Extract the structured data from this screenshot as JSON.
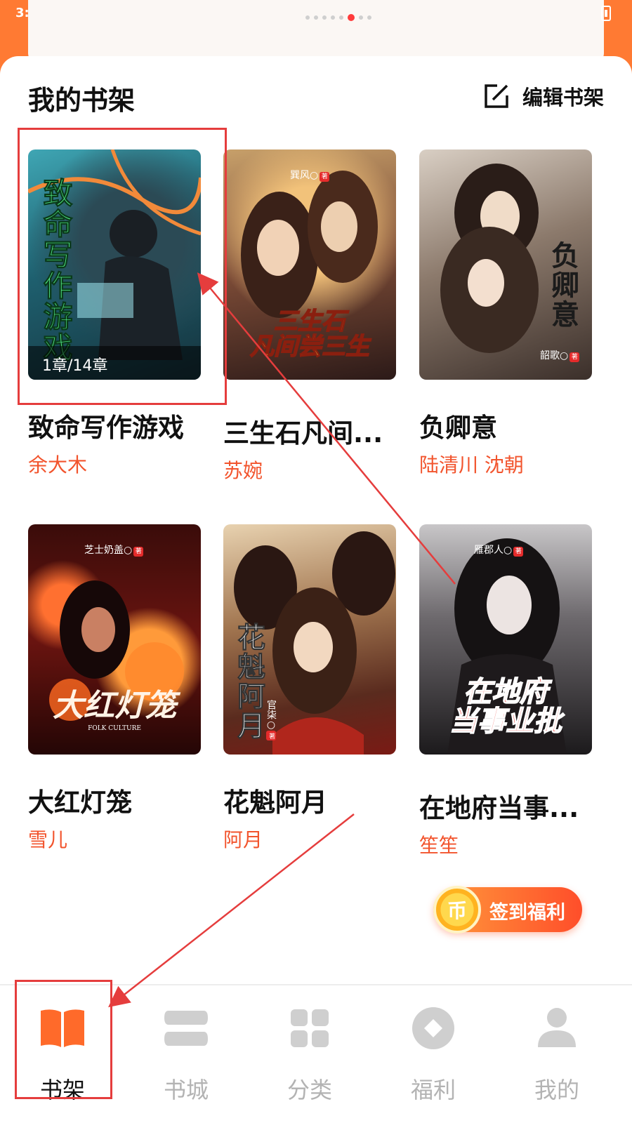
{
  "status": {
    "time": "3:"
  },
  "shelf": {
    "title": "我的书架",
    "edit_label": "编辑书架"
  },
  "books": [
    {
      "name": "致命写作游戏",
      "author": "余大木",
      "cover_title": "致命写作游戏",
      "progress": "1章/14章",
      "cover_author": ""
    },
    {
      "name": "三生石凡间...",
      "author": "苏婉",
      "cover_title": "三生石\n凡间尝三生",
      "cover_author": "巽风"
    },
    {
      "name": "负卿意",
      "author": "陆清川 沈朝",
      "cover_title": "负卿意",
      "cover_author": "韶歌"
    },
    {
      "name": "大红灯笼",
      "author": "雪儿",
      "cover_title": "大红灯笼",
      "cover_subtitle": "FOLK CULTURE",
      "cover_author": "芝士奶盖"
    },
    {
      "name": "花魁阿月",
      "author": "阿月",
      "cover_title": "花魁阿月",
      "cover_author": "官柒"
    },
    {
      "name": "在地府当事...",
      "author": "笙笙",
      "cover_title": "在地府\n当事业批",
      "cover_author": "雁郡人"
    }
  ],
  "seal_text": "著",
  "signin": {
    "coin_text": "币",
    "label": "签到福利"
  },
  "nav": [
    {
      "label": "书架",
      "icon": "book-open-icon",
      "active": true
    },
    {
      "label": "书城",
      "icon": "bookstore-icon",
      "active": false
    },
    {
      "label": "分类",
      "icon": "grid-icon",
      "active": false
    },
    {
      "label": "福利",
      "icon": "diamond-icon",
      "active": false
    },
    {
      "label": "我的",
      "icon": "person-icon",
      "active": false
    }
  ],
  "colors": {
    "accent": "#ff7a33",
    "author_red": "#f2542d",
    "annotation": "#e53d3d",
    "nav_inactive": "#b3b3b3"
  }
}
